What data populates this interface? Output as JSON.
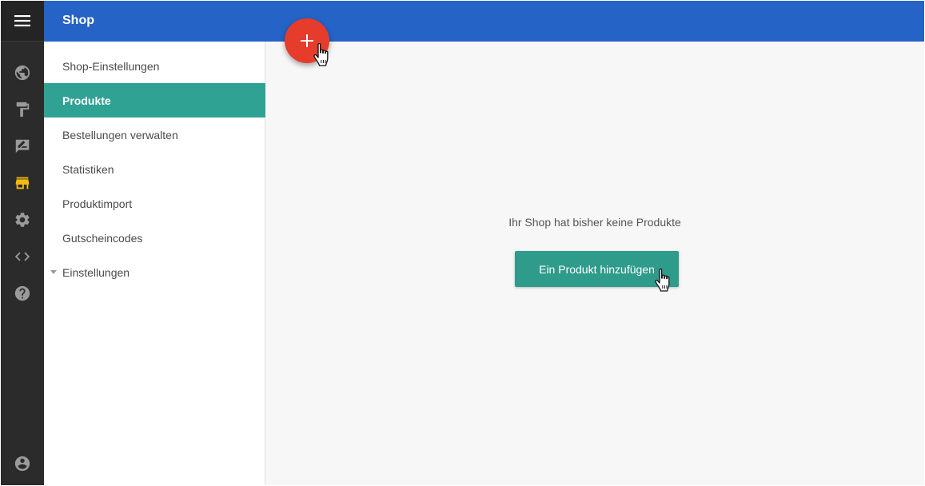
{
  "header": {
    "title": "Shop"
  },
  "rail": {
    "icons": [
      "menu-icon",
      "globe-icon",
      "paint-roller-icon",
      "edit-icon",
      "store-icon",
      "gear-icon",
      "code-icon",
      "help-icon",
      "account-icon"
    ],
    "active_icon": "store-icon",
    "active_color": "#f5b914"
  },
  "subnav": {
    "items": [
      {
        "label": "Shop-Einstellungen"
      },
      {
        "label": "Produkte",
        "active": true
      },
      {
        "label": "Bestellungen verwalten"
      },
      {
        "label": "Statistiken"
      },
      {
        "label": "Produktimport"
      },
      {
        "label": "Gutscheincodes"
      },
      {
        "label": "Einstellungen",
        "collapsible": true
      }
    ]
  },
  "main": {
    "empty_message": "Ihr Shop hat bisher keine Produkte",
    "add_product_label": "Ein Produkt hinzufügen"
  },
  "fab": {
    "label": "+"
  },
  "colors": {
    "header": "#2563c7",
    "active_nav": "#30a294",
    "primary_button": "#2f9b8b",
    "fab": "#e53c2c",
    "rail": "#2b2b2b"
  }
}
